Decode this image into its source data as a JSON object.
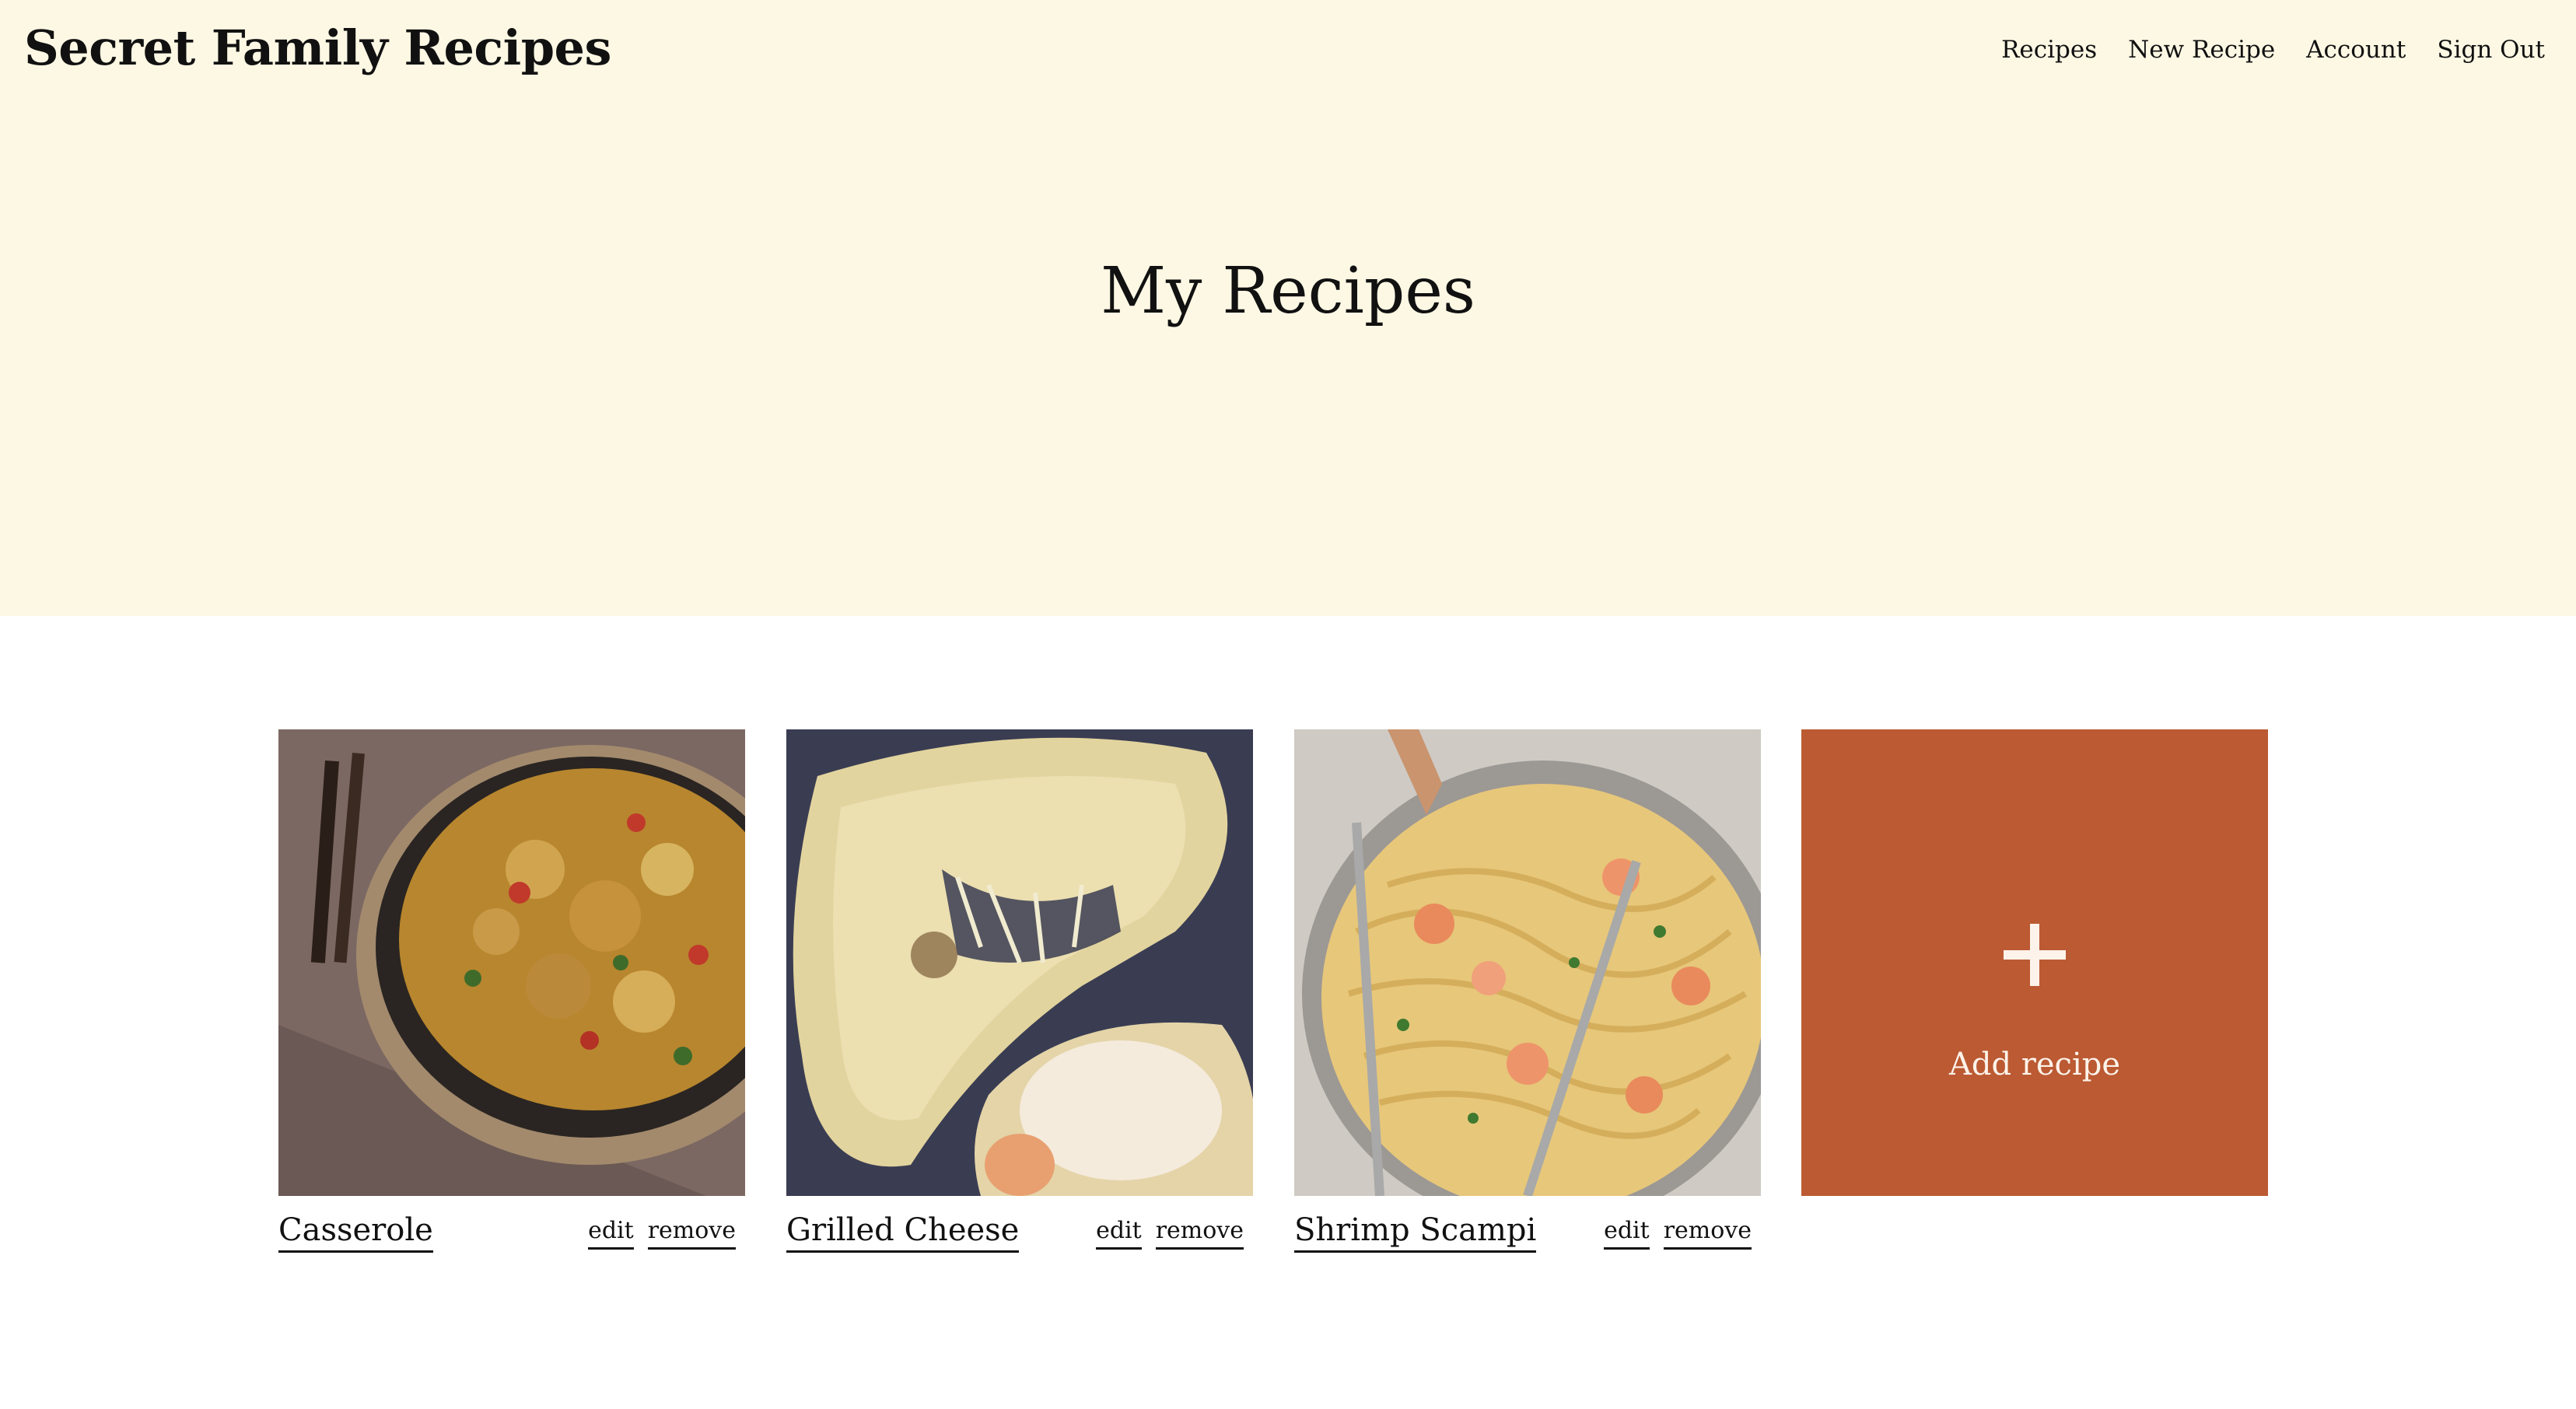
{
  "header": {
    "brand": "Secret Family Recipes",
    "nav": [
      "Recipes",
      "New Recipe",
      "Account",
      "Sign Out"
    ]
  },
  "hero": {
    "title": "My Recipes"
  },
  "recipes": [
    {
      "name": "Casserole",
      "edit_label": "edit",
      "remove_label": "remove"
    },
    {
      "name": "Grilled Cheese",
      "edit_label": "edit",
      "remove_label": "remove"
    },
    {
      "name": "Shrimp Scampi",
      "edit_label": "edit",
      "remove_label": "remove"
    }
  ],
  "add_tile": {
    "icon": "plus-icon",
    "label": "Add recipe"
  },
  "colors": {
    "hero_background": "#fdf8e4",
    "accent": "#bb5a33",
    "text": "#111111"
  }
}
